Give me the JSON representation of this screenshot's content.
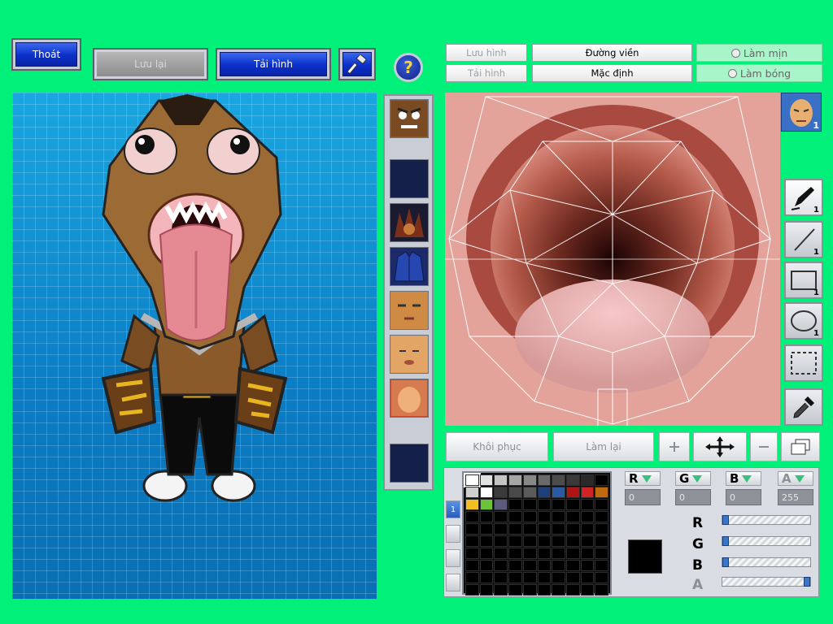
{
  "toolbar": {
    "exit_label": "Thoát",
    "save_label": "Lưu lại",
    "reload_label": "Tải hình"
  },
  "help_glyph": "?",
  "texture_tabs": {
    "save_image": "Lưu hình",
    "outline": "Đường viền",
    "smooth": "Làm mịn",
    "load_image": "Tải hình",
    "default": "Mặc định",
    "shade": "Làm bóng"
  },
  "face_badge_count": "1",
  "tools": [
    {
      "icon": "pen-icon",
      "count": "1"
    },
    {
      "icon": "line-icon",
      "count": "1"
    },
    {
      "icon": "rectangle-icon",
      "count": "1"
    },
    {
      "icon": "ellipse-icon",
      "count": "1"
    },
    {
      "icon": "selection-icon",
      "count": ""
    },
    {
      "icon": "eyedropper-icon",
      "count": ""
    }
  ],
  "edit_buttons": {
    "restore": "Khôi phục",
    "redo": "Làm lại"
  },
  "color": {
    "channels": [
      {
        "name": "R",
        "value": "0"
      },
      {
        "name": "G",
        "value": "0"
      },
      {
        "name": "B",
        "value": "0"
      },
      {
        "name": "A",
        "value": "255"
      }
    ],
    "slider_labels": [
      "R",
      "G",
      "B",
      "A"
    ],
    "slider_levels": [
      0,
      0,
      0,
      1
    ],
    "current_color": "#000000",
    "palette_row1": [
      "#ffffff",
      "#e2e2e2",
      "#c4c4c4",
      "#a6a6a6",
      "#888888",
      "#6a6a6a",
      "#4c4c4c",
      "#3a3a3a",
      "#2a2a2a",
      "#000000"
    ],
    "palette_row2": [
      "#cfcfcf",
      "#ffffff",
      "#3b3b3b",
      "#4a4a4a",
      "#5a5a5a",
      "#1e3f7a",
      "#2a5aa5",
      "#b01414",
      "#d02424",
      "#c06a10"
    ],
    "palette_row3": [
      "#f0c020",
      "#6cc33a",
      "#5c5c7a"
    ],
    "palette_page": "1"
  }
}
